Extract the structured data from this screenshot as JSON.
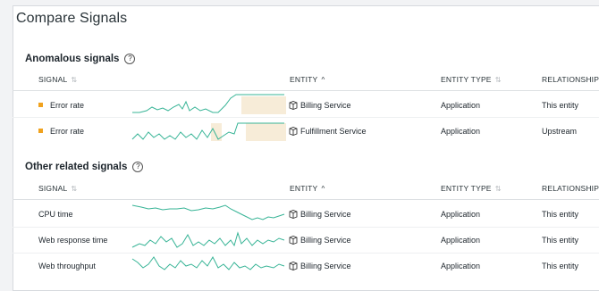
{
  "title": "Compare Signals",
  "colors": {
    "spark": "#37b496",
    "alert": "#f0a21e",
    "highlight": "#f7ecd8"
  },
  "anomalous": {
    "heading": "Anomalous signals",
    "help": "?",
    "columns": {
      "signal": "SIGNAL",
      "entity": "ENTITY",
      "entity_type": "ENTITY TYPE",
      "relationship": "RELATIONSHIP"
    },
    "rows": [
      {
        "signal": "Error rate",
        "entity": "Billing Service",
        "entity_type": "Application",
        "relationship": "This entity"
      },
      {
        "signal": "Error rate",
        "entity": "Fulfillment Service",
        "entity_type": "Application",
        "relationship": "Upstream"
      }
    ]
  },
  "related": {
    "heading": "Other related signals",
    "help": "?",
    "columns": {
      "signal": "SIGNAL",
      "entity": "ENTITY",
      "entity_type": "ENTITY TYPE",
      "relationship": "RELATIONSHIP"
    },
    "rows": [
      {
        "signal": "CPU time",
        "entity": "Billing Service",
        "entity_type": "Application",
        "relationship": "This entity"
      },
      {
        "signal": "Web response time",
        "entity": "Billing Service",
        "entity_type": "Application",
        "relationship": "This entity"
      },
      {
        "signal": "Web throughput",
        "entity": "Billing Service",
        "entity_type": "Application",
        "relationship": "This entity"
      }
    ]
  },
  "icons": {
    "sort": "sort-arrows-icon",
    "sort_up": "sort-ascending-icon",
    "entity": "entity-cube-icon",
    "alert": "alert-square-icon",
    "help": "help-circle-icon"
  }
}
